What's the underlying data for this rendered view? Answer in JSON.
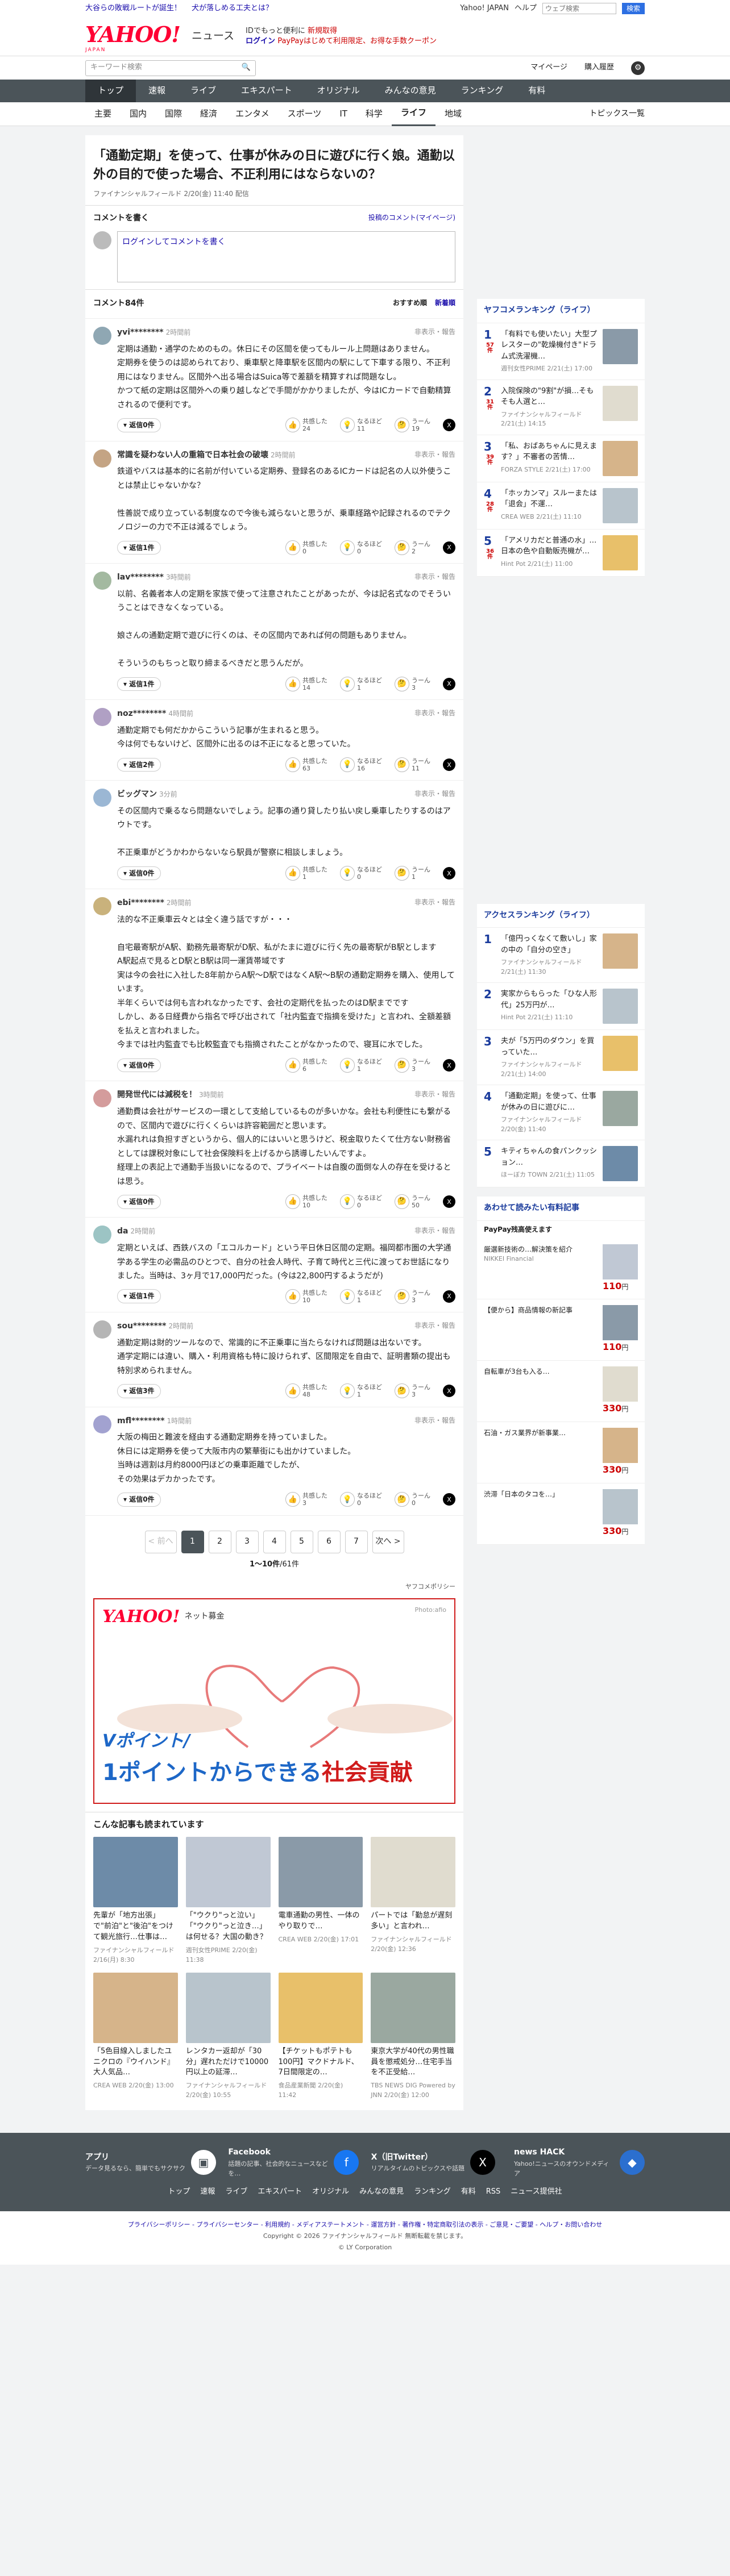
{
  "topnotice": {
    "left": [
      "大谷らの敗戦ルートが誕生！",
      "犬が落しめる工夫とは？"
    ],
    "right": [
      "Yahoo! JAPAN",
      "ヘルプ"
    ],
    "search_placeholder": "ウェブ検索",
    "search_button": "検索"
  },
  "header": {
    "logo": "YAHOO!",
    "logo_sub": "JAPAN",
    "service": "ニュース",
    "line1a": "IDでもっと便利に",
    "line1b": "新規取得",
    "line2a": "ログイン",
    "line2b": "PayPayはじめて利用限定、お得な手数クーポン"
  },
  "searchbar": {
    "placeholder": "キーワード検索",
    "links": [
      "マイページ",
      "購入履歴"
    ]
  },
  "mainnav": [
    "トップ",
    "速報",
    "ライブ",
    "エキスパート",
    "オリジナル",
    "みんなの意見",
    "ランキング",
    "有料"
  ],
  "subnav": {
    "items": [
      "主要",
      "国内",
      "国際",
      "経済",
      "エンタメ",
      "スポーツ",
      "IT",
      "科学",
      "ライフ",
      "地域"
    ],
    "more": "トピックス一覧"
  },
  "article": {
    "title": "「通勤定期」を使って、仕事が休みの日に遊びに行く娘。通勤以外の目的で使った場合、不正利用にはならないの？",
    "source": "ファイナンシャルフィールド",
    "date": "2/20(金) 11:40 配信"
  },
  "comment_form": {
    "title": "コメントを書く",
    "policy_link": "投稿のコメント(マイページ)",
    "login": "ログイン",
    "placeholder_rest": "してコメントを書く"
  },
  "comments_bar": {
    "count": "コメント84件",
    "sort_recommended": "おすすめ順",
    "sort_new": "新着順"
  },
  "comments": [
    {
      "name": "yvi********",
      "time": "2時間前",
      "report": "非表示・報告",
      "text": "定期は通勤・通学のためのもの。休日にその区間を使ってもルール上問題はありません。\n定期券を使うのは認められており、乗車駅と降車駅を区間内の駅にして下車する限り、不正利用にはなりません。区間外へ出る場合はSuica等で差額を精算すれば問題なし。\nかつて紙の定期は区間外への乗り越しなどで手間がかかりましたが、今はICカードで自動精算されるので便利です。",
      "reply": "返信0件",
      "empathy": "24",
      "insight": "11",
      "unsure": "19",
      "empathy_l": "共感した",
      "insight_l": "なるほど",
      "unsure_l": "うーん"
    },
    {
      "name": "常識を疑わない人の重箱で日本社会の破壊",
      "time": "2時間前",
      "report": "非表示・報告",
      "text": "鉄道やバスは基本的に名前が付いている定期券、登録名のあるICカードは記名の人以外使うことは禁止じゃないかな？\n\n性善説で成り立っている制度なので今後も減らないと思うが、乗車経路や記録されるのでテクノロジーの力で不正は減るでしょう。",
      "reply": "返信1件",
      "empathy": "0",
      "insight": "0",
      "unsure": "2",
      "empathy_l": "共感した",
      "insight_l": "なるほど",
      "unsure_l": "うーん"
    },
    {
      "name": "lav********",
      "time": "3時間前",
      "report": "非表示・報告",
      "text": "以前、名義者本人の定期を家族で使って注意されたことがあったが、今は記名式なのでそういうことはできなくなっている。\n\n娘さんの通勤定期で遊びに行くのは、その区間内であれば何の問題もありません。\n\nそういうのもちっと取り締まるべきだと思うんだが。",
      "reply": "返信1件",
      "empathy": "14",
      "insight": "1",
      "unsure": "3",
      "empathy_l": "共感した",
      "insight_l": "なるほど",
      "unsure_l": "うーん"
    },
    {
      "name": "noz********",
      "time": "4時間前",
      "report": "非表示・報告",
      "text": "通勤定期でも何だかからこういう記事が生まれると思う。\n今は何でもないけど、区間外に出るのは不正になると思っていた。",
      "reply": "返信2件",
      "empathy": "63",
      "insight": "16",
      "unsure": "11",
      "empathy_l": "共感した",
      "insight_l": "なるほど",
      "unsure_l": "うーん"
    },
    {
      "name": "ビッグマン",
      "time": "3分前",
      "report": "非表示・報告",
      "text": "その区間内で乗るなら問題ないでしょう。記事の通り貸したり払い戻し乗車したりするのはアウトです。\n\n不正乗車がどうかわからないなら駅員が警察に相談しましょう。",
      "reply": "返信0件",
      "empathy": "1",
      "insight": "0",
      "unsure": "1",
      "empathy_l": "共感した",
      "insight_l": "なるほど",
      "unsure_l": "うーん"
    },
    {
      "name": "ebi********",
      "time": "2時間前",
      "report": "非表示・報告",
      "text": "法的な不正乗車云々とは全く違う話ですが・・・\n\n自宅最寄駅がA駅、勤務先最寄駅がD駅、私がたまに遊びに行く先の最寄駅がB駅とします\nA駅起点で見るとD駅とB駅は同一運賃帯域です\n実は今の会社に入社した8年前からA駅〜D駅ではなくA駅〜B駅の通勤定期券を購入、使用しています。\n半年くらいでは何も言われなかったです、会社の定期代を払ったのはD駅までです\nしかし、ある日経費から指名で呼び出されて「社内監査で指摘を受けた」と言われ、全額差額を払えと言われました。\n今までは社内監査でも比較監査でも指摘されたことがなかったので、寝耳に水でした。",
      "reply": "返信0件",
      "empathy": "6",
      "insight": "1",
      "unsure": "3",
      "empathy_l": "共感した",
      "insight_l": "なるほど",
      "unsure_l": "うーん"
    },
    {
      "name": "開発世代には減税を！",
      "time": "3時間前",
      "report": "非表示・報告",
      "text": "通勤費は会社がサービスの一環として支給しているものが多いかな。会社も利便性にも繋がるので、区間内で遊びに行くくらいは許容範囲だと思います。\n水漏れれは負担すぎというから、個人的にはいいと思うけど、税金取りたくて仕方ない財務省としては課税対象にして社会保険料を上げるから誘導したいんですよ。\n経理上の表記上で通勤手当扱いになるので、プライベートは自腹の面倒な人の存在を受けるとは思う。",
      "reply": "返信0件",
      "empathy": "10",
      "insight": "0",
      "unsure": "50",
      "empathy_l": "共感した",
      "insight_l": "なるほど",
      "unsure_l": "うーん"
    },
    {
      "name": "da",
      "time": "2時間前",
      "report": "非表示・報告",
      "text": "定期といえば、西鉄バスの「エコルカード」という平日休日区間の定期。福岡都市圏の大学通学ある学生の必需品のひとつで、自分の社会人時代、子育て時代と三代に渡ってお世話になりました。当時は、3ヶ月で17,000円だった。(今は22,800円するようだが)",
      "reply": "返信1件",
      "empathy": "10",
      "insight": "1",
      "unsure": "3",
      "empathy_l": "共感した",
      "insight_l": "なるほど",
      "unsure_l": "うーん"
    },
    {
      "name": "sou********",
      "time": "2時間前",
      "report": "非表示・報告",
      "text": "通勤定期は財的ツールなので、常識的に不正乗車に当たらなければ問題は出ないです。\n通学定期には違い、購入・利用資格も特に設けられず、区間限定を自由で、証明書類の提出も特別求められません。",
      "reply": "返信3件",
      "empathy": "48",
      "insight": "1",
      "unsure": "3",
      "empathy_l": "共感した",
      "insight_l": "なるほど",
      "unsure_l": "うーん"
    },
    {
      "name": "mfl********",
      "time": "1時間前",
      "report": "非表示・報告",
      "text": "大阪の梅田と難波を経由する通勤定期券を持っていました。\n休日には定期券を使って大阪市内の繁華街にも出かけていました。\n当時は週割は月約8000円ほどの乗車距離でしたが、\nその効果はデカかったです。",
      "reply": "返信0件",
      "empathy": "3",
      "insight": "0",
      "unsure": "0",
      "empathy_l": "共感した",
      "insight_l": "なるほど",
      "unsure_l": "うーん"
    }
  ],
  "pager": {
    "prev": "< 前へ",
    "pages": [
      "1",
      "2",
      "3",
      "4",
      "5",
      "6",
      "7"
    ],
    "next": "次へ >",
    "count_bold": "1〜10件",
    "count_rest": "/61件",
    "policy": "ヤフコメポリシー"
  },
  "ad": {
    "logo": "YAHOO!",
    "logo_sub": "JAPAN",
    "sub": "ネット募金",
    "photo": "Photo:afio",
    "line1": "Vポイント/",
    "line2a": "1ポイントからできる",
    "line2b": "社会貢献"
  },
  "related": {
    "title": "こんな記事も読まれています",
    "cards": [
      {
        "t": "先輩が「地方出張」で\"前泊\"と\"後泊\"をつけて観光旅行…仕事は…",
        "s": "ファイナンシャルフィールド 2/16(月) 8:30"
      },
      {
        "t": "「\"ウクり\"っと泣い」「\"ウクり\"っと泣き…」は何せる？大国の動き？",
        "s": "週刊女性PRIME 2/20(金) 11:38"
      },
      {
        "t": "電車通勤の男性、一体のやり取りで…",
        "s": "CREA WEB 2/20(金) 17:01"
      },
      {
        "t": "パートでは「勤怠が遅刻多い」と言われ…",
        "s": "ファイナンシャルフィールド 2/20(金) 12:36"
      },
      {
        "t": "「5色目線入しましたユニクロの『ウイハンド』大人気品…",
        "s": "CREA WEB 2/20(金) 13:00"
      },
      {
        "t": "レンタカー返却が「30分」遅れただけで10000円以上の延滞…",
        "s": "ファイナンシャルフィールド 2/20(金) 10:55"
      },
      {
        "t": "【チケットもポテトも100円】マクドナルド、7日間限定の…",
        "s": "食品産業新聞 2/20(金) 11:42"
      },
      {
        "t": "東京大学が40代の男性職員を懲戒処分…住宅手当を不正受給…",
        "s": "TBS NEWS DIG Powered by JNN 2/20(金) 12:00"
      }
    ]
  },
  "ranking_yc": {
    "title": "ヤフコメランキング（ライフ）",
    "items": [
      {
        "n": "1",
        "t": "「有料でも使いたい」大型プレスターの\"乾燥機付き\"ドラム式洗濯機…",
        "src": "週刊女性PRIME 2/21(土) 17:00",
        "c": "57件"
      },
      {
        "n": "2",
        "t": "入院保険の\"9割\"が損…そもそも人選と…",
        "src": "ファイナンシャルフィールド 2/21(土) 14:15",
        "c": "31件"
      },
      {
        "n": "3",
        "t": "「私、おばあちゃんに見えます？」不審者の苦情…",
        "src": "FORZA STYLE 2/21(土) 17:00",
        "c": "39件"
      },
      {
        "n": "4",
        "t": "「ホッカンマ」スルーまたは「退会」不運…",
        "src": "CREA WEB 2/21(土) 11:10",
        "c": "28件"
      },
      {
        "n": "5",
        "t": "「アメリカだと普通の水」…日本の色や自動販売機が…",
        "src": "Hint Pot 2/21(土) 11:00",
        "c": "36件"
      }
    ]
  },
  "ranking_access": {
    "title": "アクセスランキング（ライフ）",
    "items": [
      {
        "n": "1",
        "t": "「億円っくなくて敷いし」家の中の「自分の空き」",
        "src": "ファイナンシャルフィールド 2/21(土) 11:30"
      },
      {
        "n": "2",
        "t": "実家からもらった「ひな人形代」25万円が…",
        "src": "Hint Pot 2/21(土) 11:10"
      },
      {
        "n": "3",
        "t": "夫が「5万円のダウン」を買っていた…",
        "src": "ファイナンシャルフィールド 2/21(土) 14:00"
      },
      {
        "n": "4",
        "t": "「通勤定期」を使って、仕事が休みの日に遊びに…",
        "src": "ファイナンシャルフィールド 2/20(金) 11:40"
      },
      {
        "n": "5",
        "t": "キティちゃんの食パンクッション…",
        "src": "ほーぼカ TOWN 2/21(土) 11:05"
      }
    ]
  },
  "shopping": {
    "title": "あわせて読みたい有料記事",
    "pay": "PayPay残高使えます",
    "items": [
      {
        "t": "厳選新技術の…解決策を紹介",
        "src": "NIKKEI Financial",
        "price": "110",
        "unit": "円"
      },
      {
        "t": "【便から】商品情報の新記事",
        "src": "",
        "price": "110",
        "unit": "円"
      },
      {
        "t": "自転車が3台も入る…",
        "src": "",
        "price": "330",
        "unit": "円"
      },
      {
        "t": "石油・ガス業界が新事業…",
        "src": "",
        "price": "330",
        "unit": "円"
      },
      {
        "t": "渋滞「日本のタコを…」",
        "src": "",
        "price": "330",
        "unit": "円"
      }
    ]
  },
  "footer": {
    "items": [
      {
        "t": "アプリ",
        "s": "データ見るなら、簡単でもサクサク"
      },
      {
        "t": "Facebook",
        "s": "話題の記事、社会的なニュースなどを…"
      },
      {
        "t": "X（旧Twitter）",
        "s": "リアルタイムのトピックスや話題"
      },
      {
        "t": "news HACK",
        "s": "Yahoo!ニュースのオウンドメディア"
      }
    ],
    "nav": [
      "トップ",
      "速報",
      "ライブ",
      "エキスパート",
      "オリジナル",
      "みんなの意見",
      "ランキング",
      "有料",
      "RSS",
      "ニュース提供社"
    ],
    "links": "プライバシーポリシー - プライバシーセンター - 利用規約 - メディアステートメント - 運営方針 - 著作権・特定商取引法の表示 - ご意見・ご要望 - ヘルプ・お問い合わせ",
    "copyright": "Copyright © 2026 ファイナンシャルフィールド 無断転載を禁じます。",
    "corp": "© LY Corporation"
  }
}
